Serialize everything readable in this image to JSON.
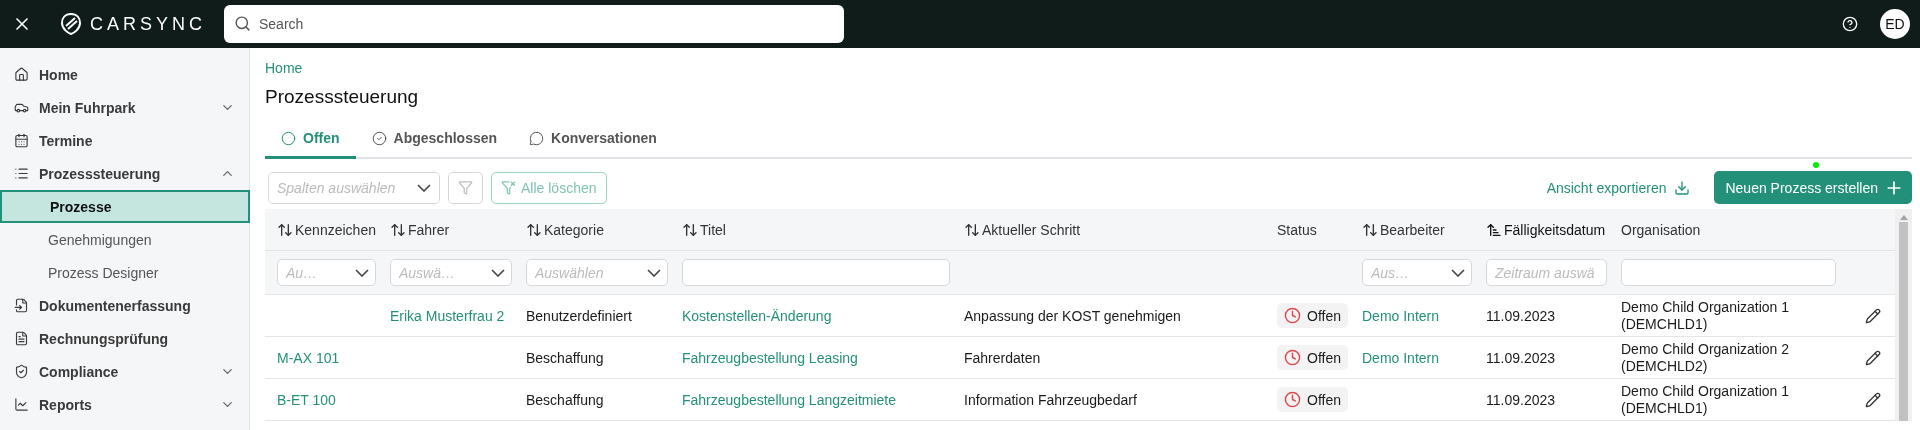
{
  "topbar": {
    "brand": "CARSYNC",
    "search": {
      "placeholder": "Search"
    },
    "avatar": "ED"
  },
  "sidebar": {
    "items": [
      {
        "label": "Home"
      },
      {
        "label": "Mein Fuhrpark",
        "expanded": false
      },
      {
        "label": "Termine"
      },
      {
        "label": "Prozesssteuerung",
        "expanded": true,
        "children": [
          {
            "label": "Prozesse",
            "selected": true
          },
          {
            "label": "Genehmigungen",
            "selected": false
          },
          {
            "label": "Prozess Designer",
            "selected": false
          }
        ]
      },
      {
        "label": "Dokumentenerfassung"
      },
      {
        "label": "Rechnungsprüfung"
      },
      {
        "label": "Compliance",
        "expanded": false
      },
      {
        "label": "Reports",
        "expanded": false
      }
    ]
  },
  "breadcrumb": "Home",
  "title": "Prozesssteuerung",
  "tabs": [
    {
      "label": "Offen",
      "selected": true
    },
    {
      "label": "Abgeschlossen",
      "selected": false
    },
    {
      "label": "Konversationen",
      "selected": false
    }
  ],
  "toolbar": {
    "columns_select": {
      "placeholder": "Spalten auswählen"
    },
    "clear_button": "Alle löschen",
    "export_link": "Ansicht exportieren",
    "create_button": "Neuen Prozess erstellen"
  },
  "table": {
    "columns": [
      {
        "label": "Kennzeichen",
        "sortable": true,
        "sorted": false,
        "filter": {
          "kind": "select",
          "placeholder": "Au…"
        }
      },
      {
        "label": "Fahrer",
        "sortable": true,
        "sorted": false,
        "filter": {
          "kind": "select",
          "placeholder": "Auswä…"
        }
      },
      {
        "label": "Kategorie",
        "sortable": true,
        "sorted": false,
        "filter": {
          "kind": "select",
          "placeholder": "Auswählen"
        }
      },
      {
        "label": "Titel",
        "sortable": true,
        "sorted": false,
        "filter": {
          "kind": "text"
        }
      },
      {
        "label": "Aktueller Schritt",
        "sortable": true,
        "sorted": false
      },
      {
        "label": "Status",
        "sortable": false,
        "sorted": false
      },
      {
        "label": "Bearbeiter",
        "sortable": true,
        "sorted": false,
        "filter": {
          "kind": "select",
          "placeholder": "Aus…"
        }
      },
      {
        "label": "Fälligkeitsdatum",
        "sortable": true,
        "sorted": true,
        "filter": {
          "kind": "text",
          "placeholder": "Zeitraum auswä"
        }
      },
      {
        "label": "Organisation",
        "sortable": false,
        "sorted": false,
        "filter": {
          "kind": "text"
        }
      }
    ],
    "rows": [
      {
        "fahrer": "Erika Musterfrau 2",
        "kategorie": "Benutzerdefiniert",
        "titel": "Kostenstellen-Änderung",
        "schritt": "Anpassung der KOST genehmigen",
        "status": "Offen",
        "bearbeiter": "Demo Intern",
        "faellig": "11.09.2023",
        "organisation": "Demo Child Organization 1 (DEMCHLD1)"
      },
      {
        "kennzeichen": "M-AX 101",
        "kategorie": "Beschaffung",
        "titel": "Fahrzeugbestellung Leasing",
        "schritt": "Fahrerdaten",
        "status": "Offen",
        "bearbeiter": "Demo Intern",
        "faellig": "11.09.2023",
        "organisation": "Demo Child Organization 2 (DEMCHLD2)"
      },
      {
        "kennzeichen": "B-ET 100",
        "kategorie": "Beschaffung",
        "titel": "Fahrzeugbestellung Langzeitmiete",
        "schritt": "Information Fahrzeugbedarf",
        "status": "Offen",
        "faellig": "11.09.2023",
        "organisation": "Demo Child Organization 1 (DEMCHLD1)"
      }
    ]
  }
}
